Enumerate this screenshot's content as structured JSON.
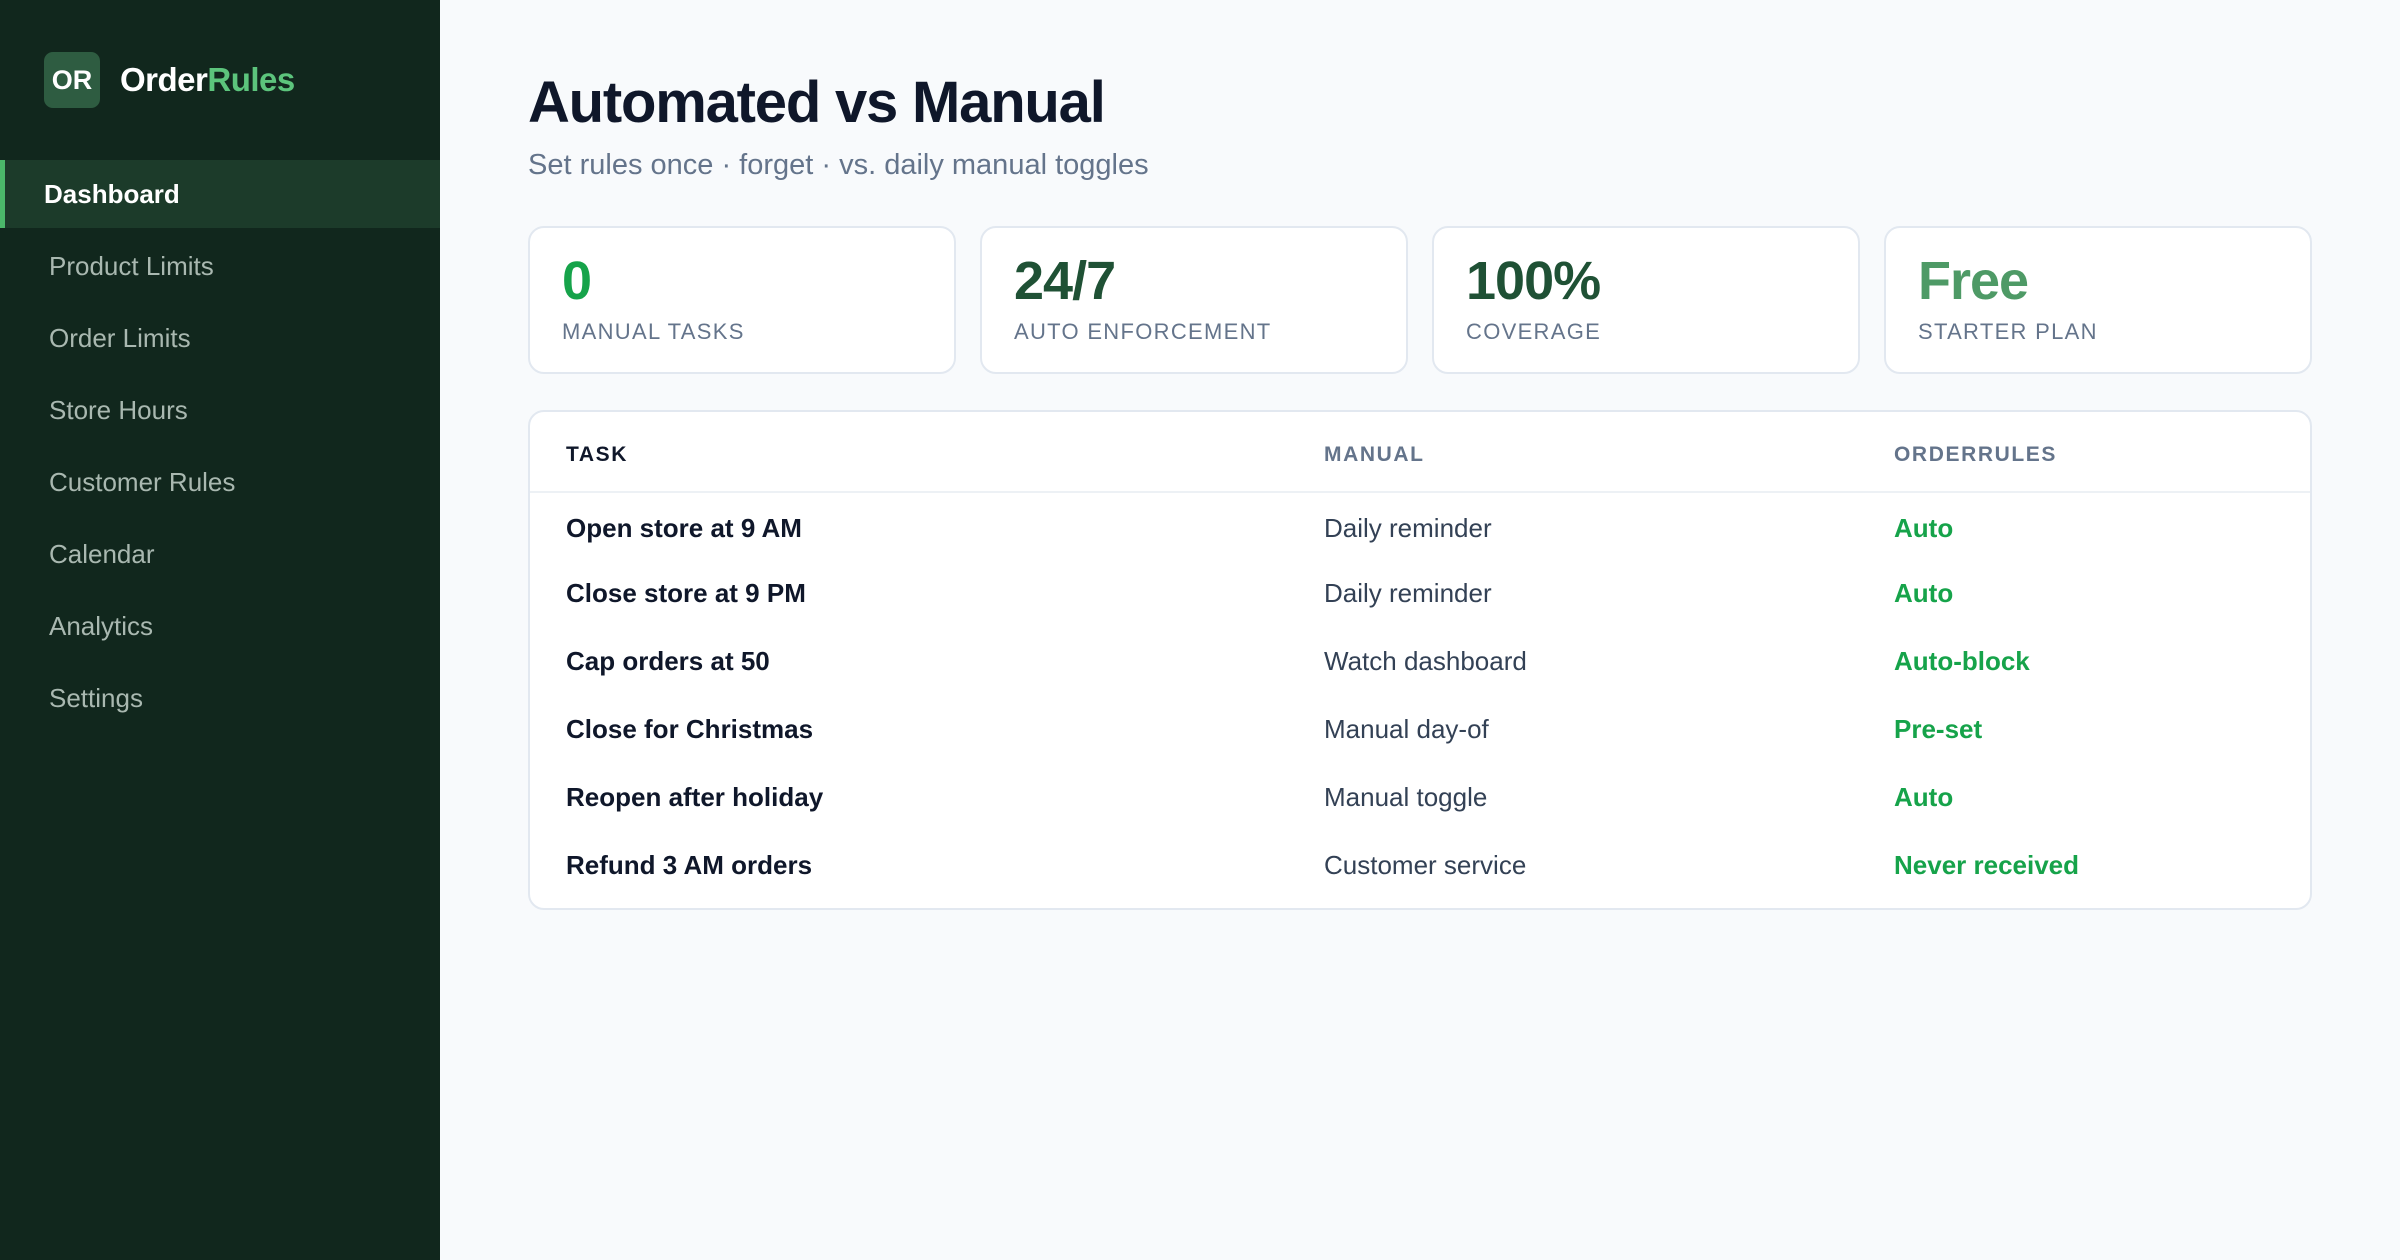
{
  "brand": {
    "badge": "OR",
    "name_part1": "Order",
    "name_part2": "Rules"
  },
  "nav": [
    {
      "label": "Dashboard",
      "active": true
    },
    {
      "label": "Product Limits"
    },
    {
      "label": "Order Limits"
    },
    {
      "label": "Store Hours"
    },
    {
      "label": "Customer Rules"
    },
    {
      "label": "Calendar"
    },
    {
      "label": "Analytics"
    },
    {
      "label": "Settings"
    }
  ],
  "header": {
    "title": "Automated vs Manual",
    "subtitle": "Set rules once · forget · vs. daily manual toggles"
  },
  "stats": [
    {
      "value": "0",
      "label": "MANUAL TASKS",
      "color": "#16a34a"
    },
    {
      "value": "24/7",
      "label": "AUTO ENFORCEMENT",
      "color": "#1f5135"
    },
    {
      "value": "100%",
      "label": "COVERAGE",
      "color": "#1f5135"
    },
    {
      "value": "Free",
      "label": "STARTER PLAN",
      "color": "#4e9a66"
    }
  ],
  "table": {
    "headers": {
      "task": "TASK",
      "manual": "MANUAL",
      "auto": "ORDERRULES"
    },
    "rows": [
      {
        "task": "Open store at 9 AM",
        "manual": "Daily reminder",
        "auto": "Auto"
      },
      {
        "task": "Close store at 9 PM",
        "manual": "Daily reminder",
        "auto": "Auto"
      },
      {
        "task": "Cap orders at 50",
        "manual": "Watch dashboard",
        "auto": "Auto-block"
      },
      {
        "task": "Close for Christmas",
        "manual": "Manual day-of",
        "auto": "Pre-set"
      },
      {
        "task": "Reopen after holiday",
        "manual": "Manual toggle",
        "auto": "Auto"
      },
      {
        "task": "Refund 3 AM orders",
        "manual": "Customer service",
        "auto": "Never received"
      }
    ]
  }
}
